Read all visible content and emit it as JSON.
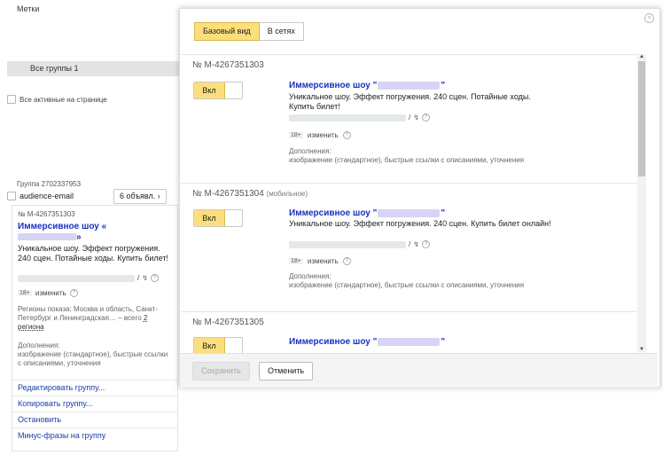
{
  "background": {
    "metki_label": "Метки",
    "all_groups_label": "Все группы",
    "all_groups_count": "1",
    "all_active_label": "Все активные на странице",
    "group_id": "Группа 2702337953",
    "group_name": "audience-email",
    "ads_button": "6 объявл.",
    "chevron": "›",
    "ad": {
      "number": "№ M-4267351303",
      "title_start": "Иммерсивное шоу «",
      "title_end": "»",
      "text": "Уникальное шоу. Эффект погружения. 240 сцен. Потайные ходы. Купить билет!",
      "url_suffix": "/",
      "age": "18+",
      "change": "изменить",
      "regions_text": "Регионы показа: Москва и область, Санкт-Петербург и Ленинградская… – всего",
      "regions_link": "2 региона",
      "addons_label": "Дополнения:",
      "addons_text": "изображение (стандартное), быстрые ссылки с описаниями, уточнения"
    },
    "menu": [
      "Редактировать группу...",
      "Копировать группу...",
      "Остановить",
      "Минус-фразы на группу"
    ]
  },
  "modal": {
    "close": "×",
    "tabs": [
      {
        "label": "Базовый вид",
        "active": true
      },
      {
        "label": "В сетях",
        "active": false
      }
    ],
    "items": [
      {
        "number": "№ M-4267351303",
        "number_suffix": "",
        "toggle": "Вкл",
        "title_start": "Иммерсивное шоу \"",
        "title_end": "\"",
        "text": "Уникальное шоу. Эффект погружения. 240 сцен. Потайные ходы. Купить билет!",
        "url_suffix": "/",
        "age": "18+",
        "change": "изменить",
        "addons_label": "Дополнения:",
        "addons_text": "изображение (стандартное), быстрые ссылки с описаниями, уточнения"
      },
      {
        "number": "№ M-4267351304",
        "number_suffix": "(мобильное)",
        "toggle": "Вкл",
        "title_start": "Иммерсивное шоу \"",
        "title_end": "\"",
        "text": "Уникальное шоу. Эффект погружения. 240 сцен. Купить билет онлайн!",
        "url_suffix": "/",
        "age": "18+",
        "change": "изменить",
        "addons_label": "Дополнения:",
        "addons_text": "изображение (стандартное), быстрые ссылки с описаниями, уточнения"
      },
      {
        "number": "№ M-4267351305",
        "number_suffix": "",
        "toggle": "Вкл",
        "title_start": "Иммерсивное шоу \"",
        "title_end": "\""
      }
    ],
    "footer": {
      "save": "Сохранить",
      "cancel": "Отменить"
    }
  }
}
